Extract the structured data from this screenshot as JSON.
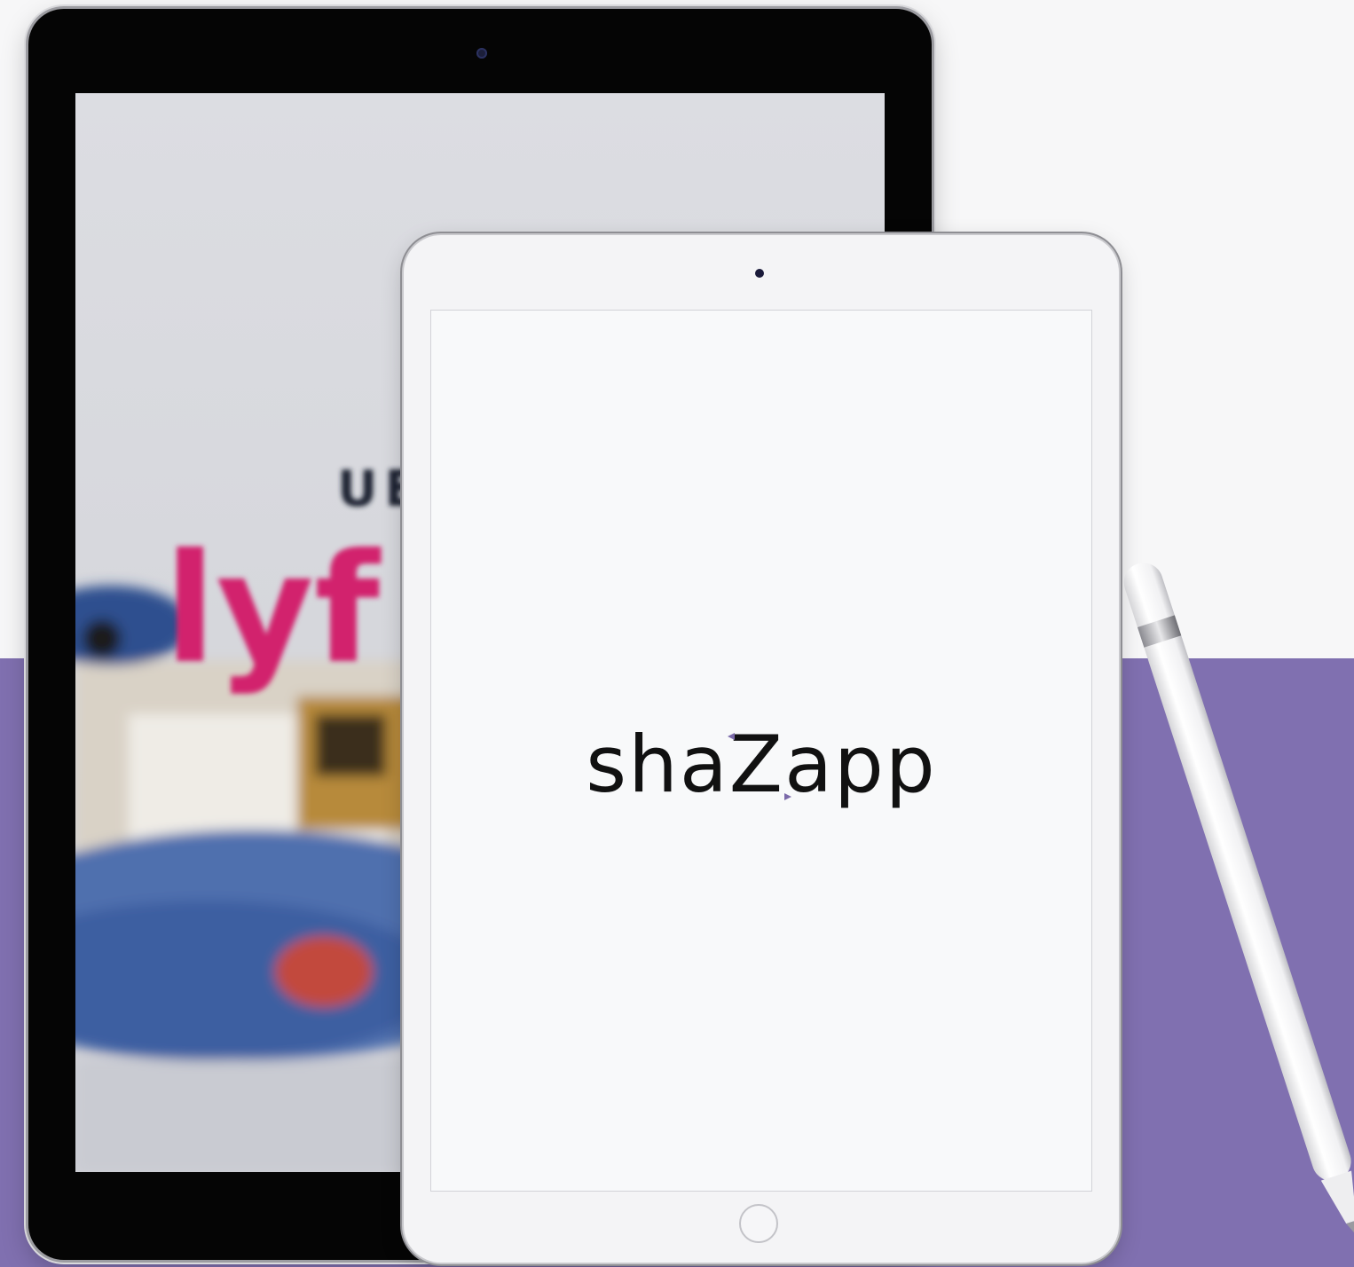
{
  "colors": {
    "background": "#f7f7f8",
    "band": "#8070b0",
    "logo_text": "#111111",
    "logo_accent": "#7b6aa9",
    "ipad_black_bezel": "#050505",
    "ipad_white_bezel": "#f4f4f6"
  },
  "ipad_black": {
    "screen_photo": {
      "signs": [
        "UE",
        "lyf"
      ]
    }
  },
  "ipad_white": {
    "logo": {
      "part1": "sha",
      "part2": "Z",
      "part3": "app"
    }
  },
  "icons": [
    "camera-icon",
    "home-button-icon",
    "apple-pencil-icon"
  ]
}
